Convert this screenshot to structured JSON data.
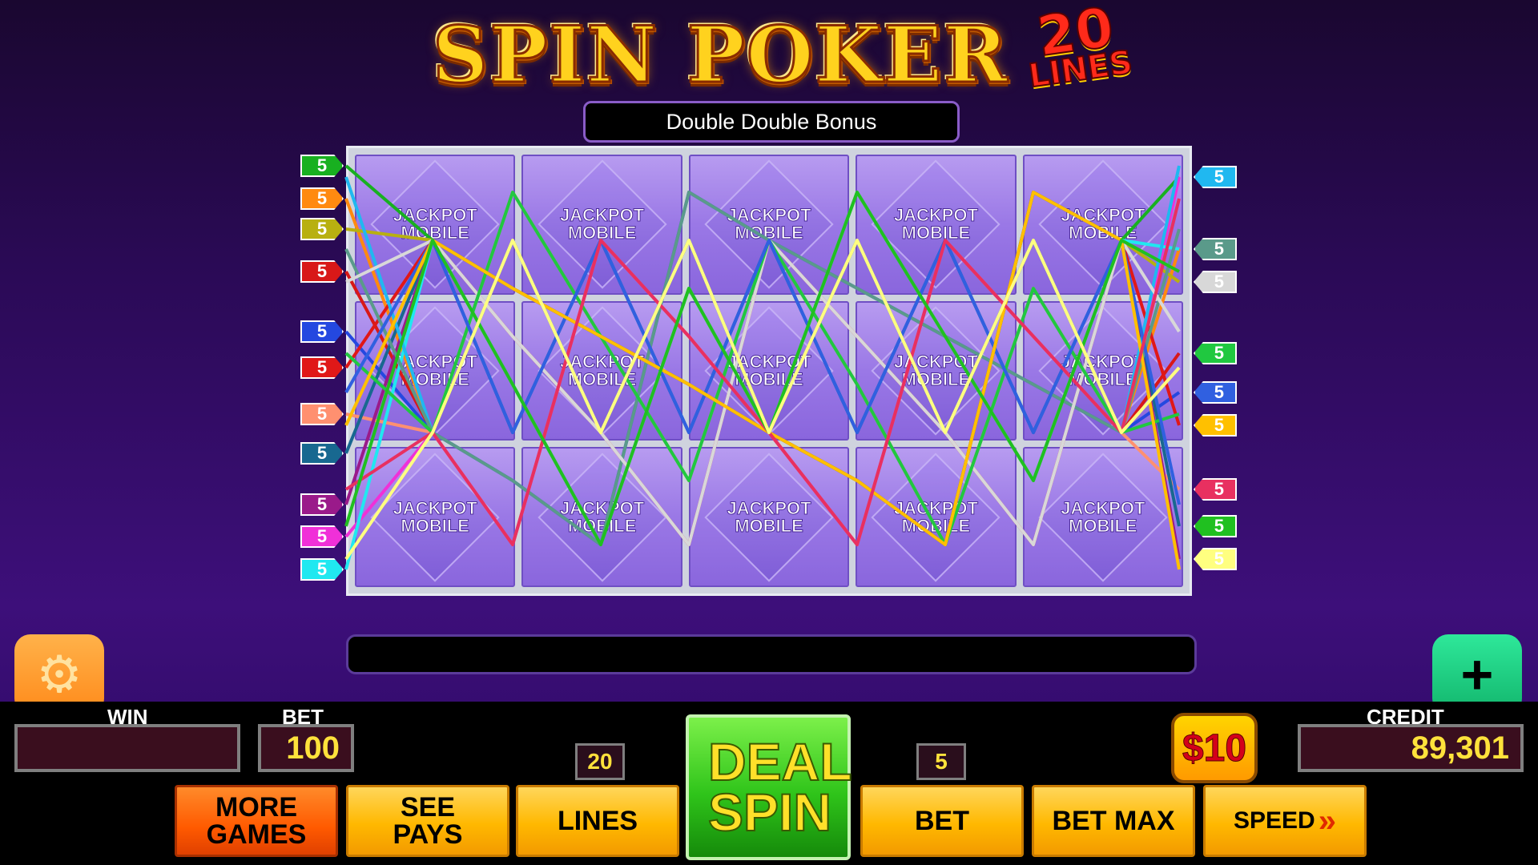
{
  "logo": {
    "title": "SPIN POKER",
    "badge_number": "20",
    "badge_text": "LINES"
  },
  "variant": "Double Double Bonus",
  "card_text": [
    "JACKPOT",
    "MOBILE"
  ],
  "left_tags": [
    {
      "value": "5",
      "color": "#18b020"
    },
    {
      "value": "5",
      "color": "#ff8a10"
    },
    {
      "value": "5",
      "color": "#b8b010"
    },
    {
      "value": "5",
      "color": "#d81818"
    },
    {
      "value": "5",
      "color": "#2448e0"
    },
    {
      "value": "5",
      "color": "#e01818"
    },
    {
      "value": "5",
      "color": "#ff9070"
    },
    {
      "value": "5",
      "color": "#186890"
    },
    {
      "value": "5",
      "color": "#9a1a8a"
    },
    {
      "value": "5",
      "color": "#f030d8"
    },
    {
      "value": "5",
      "color": "#20e8f0"
    }
  ],
  "right_tags": [
    {
      "value": "5",
      "color": "#20b8f0"
    },
    {
      "value": "5",
      "color": "#5a9a8a"
    },
    {
      "value": "5",
      "color": "#d8d8d8"
    },
    {
      "value": "5",
      "color": "#20c840"
    },
    {
      "value": "5",
      "color": "#3060e0"
    },
    {
      "value": "5",
      "color": "#ffc000"
    },
    {
      "value": "5",
      "color": "#e83060"
    },
    {
      "value": "5",
      "color": "#20c020"
    },
    {
      "value": "5",
      "color": "#ffff80"
    }
  ],
  "console": {
    "win_label": "WIN",
    "win_value": "",
    "bet_label": "BET",
    "bet_value": "100",
    "credit_label": "CREDIT",
    "credit_value": "89,301",
    "lines_value": "20",
    "bet_per_line": "5",
    "denomination": "$10"
  },
  "buttons": {
    "more_games": "MORE GAMES",
    "see_pays": "SEE PAYS",
    "lines": "LINES",
    "deal_spin": "DEAL SPIN",
    "bet": "BET",
    "bet_max": "BET MAX",
    "speed": "SPEED"
  },
  "icons": {
    "settings": "gear-icon",
    "add_credits": "plus-icon",
    "speed_arrows": "double-chevron-icon"
  }
}
